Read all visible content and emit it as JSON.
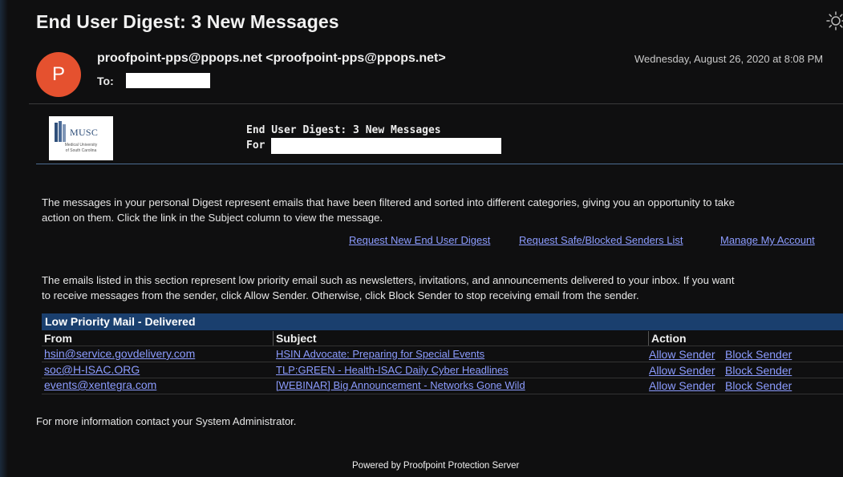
{
  "email": {
    "subject": "End User Digest: 3 New Messages",
    "avatar_letter": "P",
    "sender": "proofpoint-pps@ppops.net <proofpoint-pps@ppops.net>",
    "to_label": "To:",
    "date": "Wednesday, August 26, 2020 at 8:08 PM"
  },
  "digest": {
    "logo": {
      "name": "MUSC",
      "line1": "Medical University",
      "line2": "of South Carolina"
    },
    "title": "End User Digest: 3 New Messages",
    "for_label": "For",
    "intro_line1": "The messages in your personal Digest represent emails that have been filtered and sorted into different categories, giving you an opportunity to take",
    "intro_line2": "action on them. Click the link in the Subject column to view the message.",
    "links": {
      "request_digest": "Request New End User Digest",
      "request_list": "Request Safe/Blocked Senders List",
      "manage_account": "Manage My Account"
    },
    "section_desc_line1": "The emails listed in this section represent low priority email such as newsletters, invitations, and announcements delivered to your inbox. If you want",
    "section_desc_line2": "to receive messages from the sender, click Allow Sender. Otherwise, click Block Sender to stop receiving email from the sender.",
    "table": {
      "title": "Low Priority Mail - Delivered",
      "columns": {
        "from": "From",
        "subject": "Subject",
        "action": "Action"
      },
      "rows": [
        {
          "from": "hsin@service.govdelivery.com",
          "subject": "HSIN Advocate: Preparing for Special Events",
          "allow": "Allow Sender",
          "block": "Block Sender"
        },
        {
          "from": "soc@H-ISAC.ORG",
          "subject": "TLP:GREEN - Health-ISAC Daily Cyber Headlines",
          "allow": "Allow Sender",
          "block": "Block Sender"
        },
        {
          "from": "events@xentegra.com",
          "subject": "[WEBINAR] Big Announcement - Networks Gone Wild",
          "allow": "Allow Sender",
          "block": "Block Sender"
        }
      ]
    },
    "footer_info": "For more information contact your System Administrator.",
    "powered_by": "Powered by Proofpoint Protection Server"
  },
  "icons": {
    "theme": "sun-icon"
  },
  "colors": {
    "background": "#0f0f10",
    "avatar": "#e5512f",
    "link": "#8c9cff",
    "table_header": "#1a3f6e"
  }
}
